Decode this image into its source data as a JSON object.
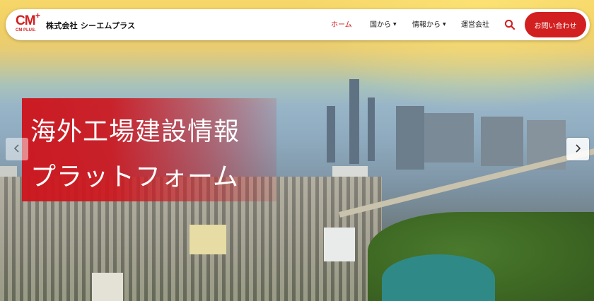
{
  "header": {
    "logo_text": "CM",
    "logo_plus": "+",
    "logo_sub": "CM PLUS.",
    "company_name": "株式会社 シーエムプラス",
    "nav": [
      {
        "label": "ホーム",
        "active": true
      },
      {
        "label": "国から",
        "dropdown": true
      },
      {
        "label": "情報から",
        "dropdown": true
      },
      {
        "label": "運営会社"
      }
    ],
    "search_icon": "search-icon",
    "contact_label": "お問い合わせ",
    "accent_color": "#d21f1f"
  },
  "hero": {
    "title_line1": "海外工場建設情報",
    "title_line2": "プラットフォーム",
    "prev_icon": "chevron-left-icon",
    "next_icon": "chevron-right-icon"
  }
}
